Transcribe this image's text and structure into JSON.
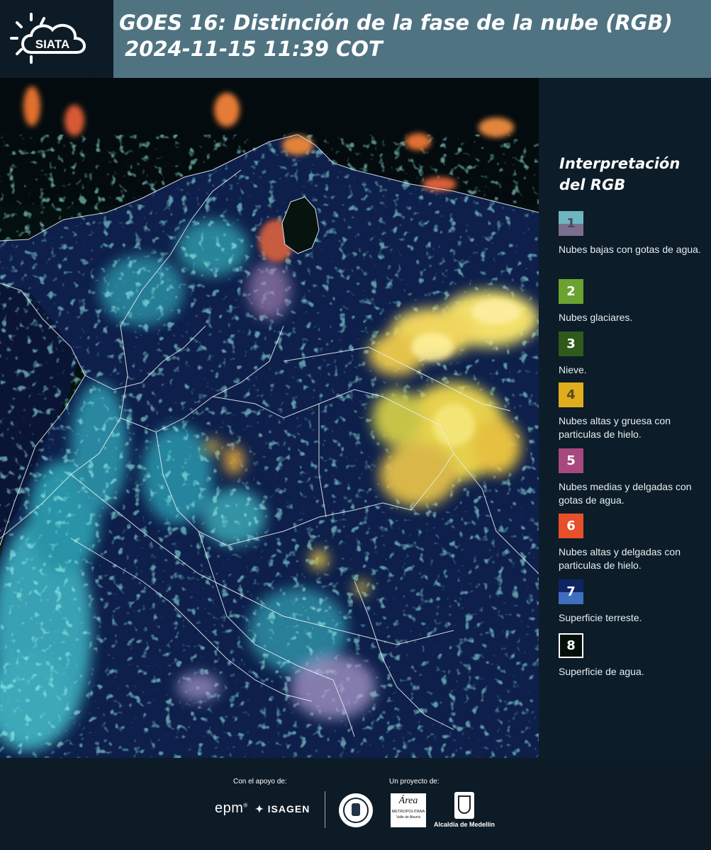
{
  "header": {
    "logo_text": "SIATA",
    "title_line1": "GOES 16: Distinción de la fase de la nube (RGB)",
    "title_line2": "2024-11-15 11:39 COT"
  },
  "legend": {
    "title": "Interpretación del RGB",
    "items": [
      {
        "num": "1",
        "desc": "Nubes bajas con gotas de agua.",
        "color_top": "#6fb6c3",
        "color_bottom": "#7b6f8e"
      },
      {
        "num": "2",
        "desc": "Nubes glaciares.",
        "color": "#6aa32f"
      },
      {
        "num": "3",
        "desc": "Nieve.",
        "color": "#2f5a1b"
      },
      {
        "num": "4",
        "desc": "Nubes altas y gruesa con particulas de hielo.",
        "color": "#e0ad1c"
      },
      {
        "num": "5",
        "desc": "Nubes medias y delgadas con gotas de agua.",
        "color": "#a9487f"
      },
      {
        "num": "6",
        "desc": "Nubes altas y delgadas con particulas de hielo.",
        "color": "#e6502a"
      },
      {
        "num": "7",
        "desc": "Superficie terreste.",
        "color_top": "#0f2463",
        "color_bottom": "#3f6ec0"
      },
      {
        "num": "8",
        "desc": "Superficie de agua.",
        "color": "#050f0a"
      }
    ]
  },
  "footer": {
    "support_label": "Con el apoyo de:",
    "project_label": "Un proyecto de:",
    "brand_epm": "epm",
    "brand_isagen": "ISAGEN",
    "brand_area_line1": "Área",
    "brand_area_line2": "METROPOLITANA",
    "brand_area_line3": "Valle de Aburrá",
    "brand_alcaldia": "Alcaldía de Medellín"
  }
}
